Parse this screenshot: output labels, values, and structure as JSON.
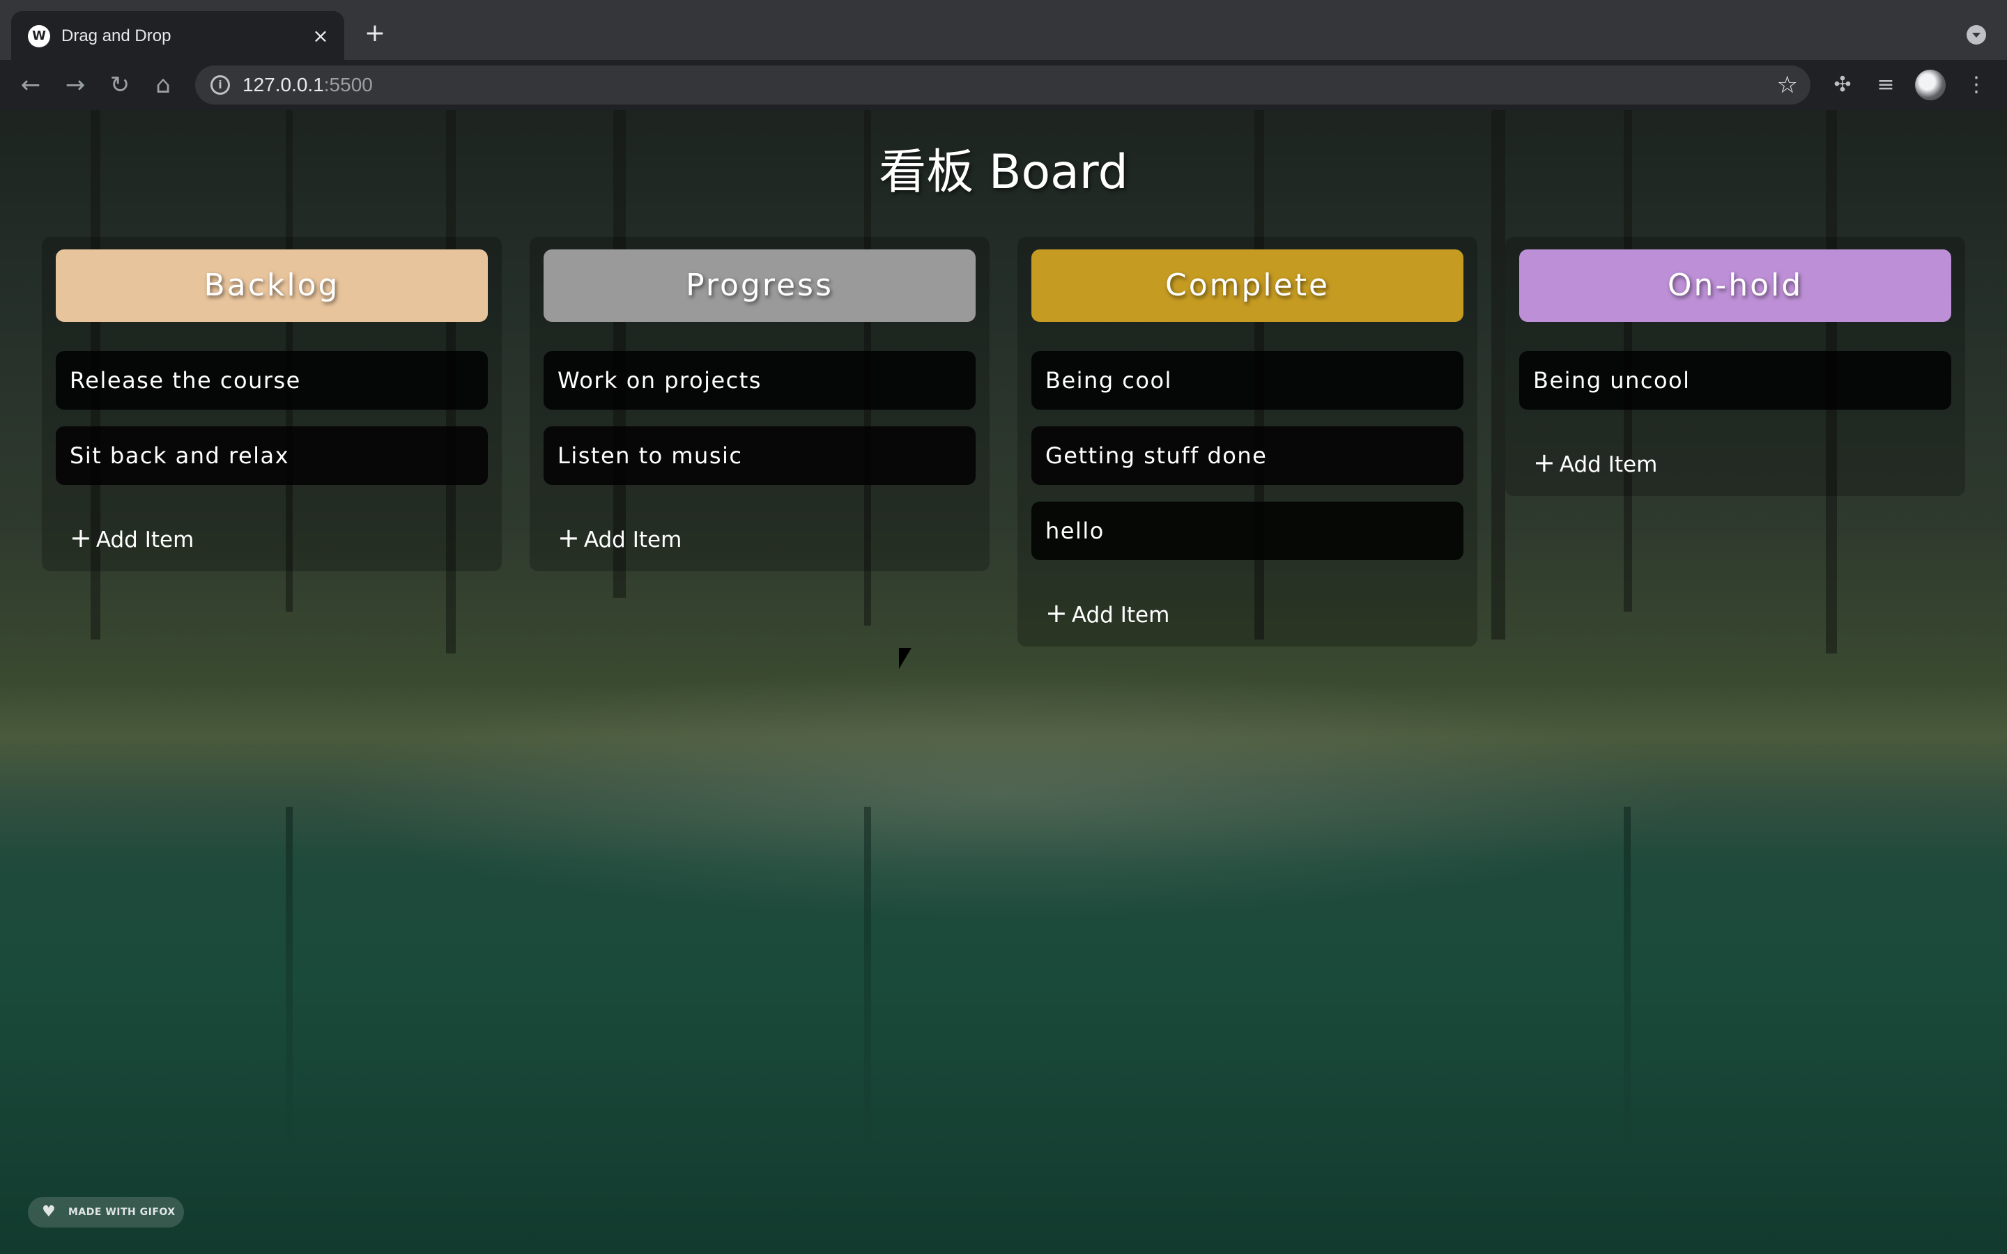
{
  "browser": {
    "tab_title": "Drag and Drop",
    "tab_favicon": "W",
    "tab_close": "×",
    "new_tab": "+",
    "url_host": "127.0.0.1",
    "url_port": ":5500",
    "icons": {
      "back": "arrow-left-icon",
      "forward": "arrow-right-icon",
      "reload": "reload-icon",
      "home": "home-icon",
      "info": "info-icon",
      "bookmark": "star-icon",
      "extensions": "puzzle-icon",
      "media": "playlist-icon",
      "menu": "more-vert-icon"
    }
  },
  "board": {
    "title": "看板 Board",
    "add_label": "Add Item",
    "columns": [
      {
        "name": "Backlog",
        "color": "#e8c49c",
        "items": [
          "Release the course",
          "Sit back and relax"
        ]
      },
      {
        "name": "Progress",
        "color": "#9a9a9a",
        "items": [
          "Work on projects",
          "Listen to music"
        ]
      },
      {
        "name": "Complete",
        "color": "#c59b22",
        "items": [
          "Being cool",
          "Getting stuff done",
          "hello"
        ]
      },
      {
        "name": "On-hold",
        "color": "#bd8fd6",
        "items": [
          "Being uncool"
        ]
      }
    ]
  },
  "watermark": "MADE WITH GIFOX"
}
